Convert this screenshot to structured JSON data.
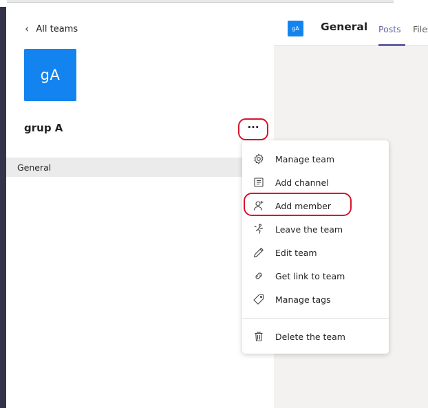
{
  "sidebar": {
    "back_label": "All teams",
    "team_avatar": "gA",
    "team_name": "grup A",
    "more_label": "···",
    "channels": [
      {
        "label": "General"
      }
    ]
  },
  "main": {
    "channel_avatar": "gA",
    "channel_title": "General",
    "tabs": [
      {
        "label": "Posts",
        "active": true
      },
      {
        "label": "Files",
        "active": false
      }
    ]
  },
  "menu": {
    "items": [
      {
        "label": "Manage team",
        "icon": "gear-icon"
      },
      {
        "label": "Add channel",
        "icon": "channel-list-icon"
      },
      {
        "label": "Add member",
        "icon": "add-person-icon",
        "highlighted": true
      },
      {
        "label": "Leave the team",
        "icon": "leave-icon"
      },
      {
        "label": "Edit team",
        "icon": "pencil-icon"
      },
      {
        "label": "Get link to team",
        "icon": "link-icon"
      },
      {
        "label": "Manage tags",
        "icon": "tag-icon"
      },
      {
        "label": "Delete the team",
        "icon": "trash-icon"
      }
    ]
  },
  "colors": {
    "accent": "#6264a7",
    "team_blue": "#1384ef",
    "highlight_red": "#d9132b",
    "app_bar": "#33344a"
  }
}
